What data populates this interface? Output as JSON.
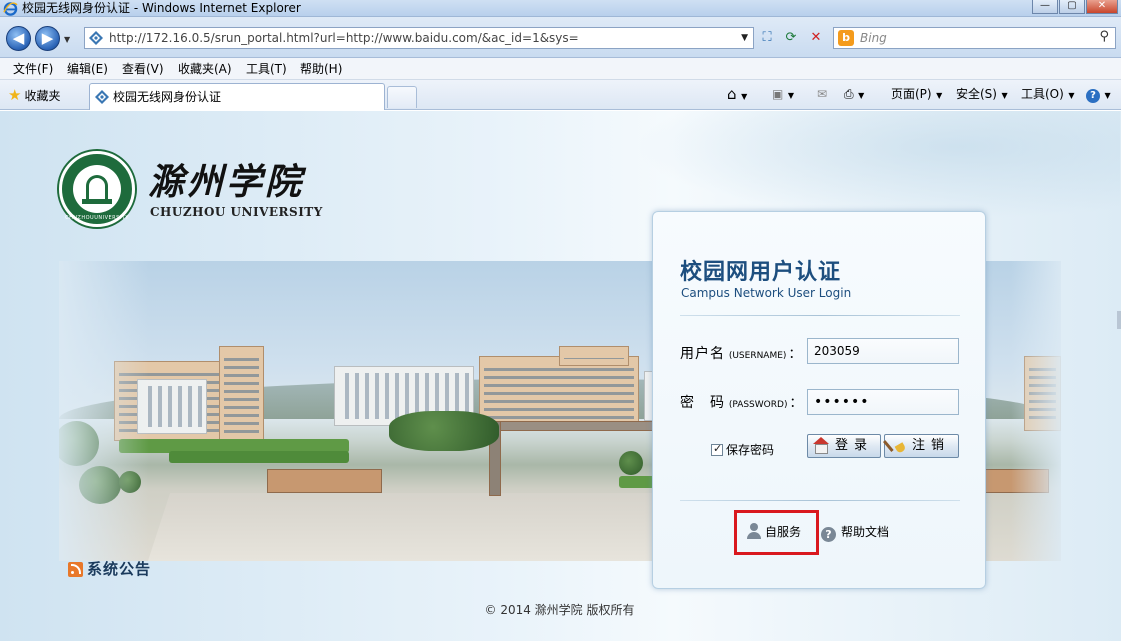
{
  "window": {
    "title": "校园无线网身份认证 - Windows Internet Explorer",
    "controls": [
      "—",
      "▢",
      "✕"
    ]
  },
  "addressbar": {
    "url": "http://172.16.0.5/srun_portal.html?url=http://www.baidu.com/&ac_id=1&sys=",
    "search_placeholder": "Bing"
  },
  "menubar": {
    "items": [
      "文件(F)",
      "编辑(E)",
      "查看(V)",
      "收藏夹(A)",
      "工具(T)",
      "帮助(H)"
    ]
  },
  "favbar": {
    "favorites_label": "收藏夹",
    "tab_title": "校园无线网身份认证",
    "commands": {
      "page": "页面(P)",
      "safety": "安全(S)",
      "tools": "工具(O)"
    }
  },
  "header": {
    "university_cn": "滁州学院",
    "university_en": "CHUZHOU UNIVERSITY",
    "emblem_ring_text": "CHUZHOUUNIVERSITY"
  },
  "login": {
    "title": "校园网用户认证",
    "subtitle": "Campus Network User Login",
    "username_label_cn": "用户名",
    "username_label_en": "(USERNAME)",
    "username_value": "203059",
    "password_label_cn": "密　码",
    "password_label_en": "(PASSWORD)",
    "password_value": "••••••",
    "colon": "：",
    "remember_label": "保存密码",
    "remember_checked": true,
    "login_button": "登录",
    "logout_button": "注销",
    "self_service_link": "自服务",
    "help_link": "帮助文档"
  },
  "announcements": {
    "label": "系统公告"
  },
  "footer": {
    "copyright": "© 2014 滁州学院 版权所有"
  },
  "colors": {
    "title_blue": "#1d4e7f",
    "highlight_red": "#d9181e",
    "emblem_green": "#1e6b3c"
  }
}
